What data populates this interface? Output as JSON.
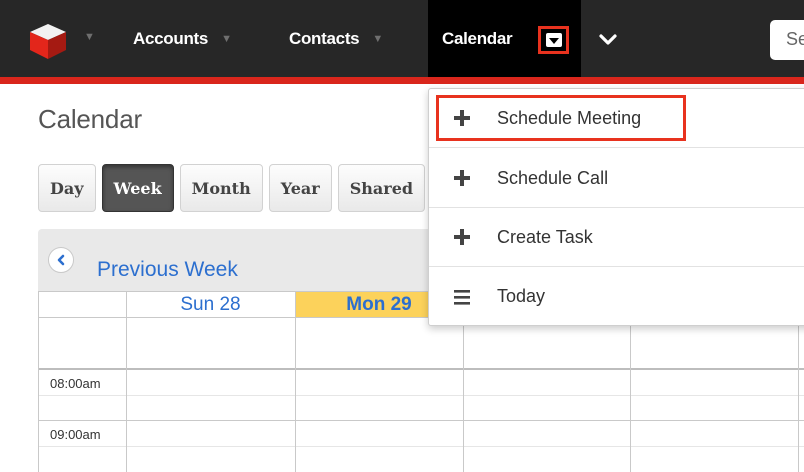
{
  "nav": {
    "items": [
      {
        "label": "Accounts"
      },
      {
        "label": "Contacts"
      },
      {
        "label": "Calendar"
      }
    ],
    "search_text": "Se"
  },
  "page": {
    "title": "Calendar"
  },
  "view_buttons": [
    "Day",
    "Week",
    "Month",
    "Year",
    "Shared"
  ],
  "active_view": "Week",
  "calendar": {
    "prev_label": "Previous Week",
    "days": [
      "Sun 28",
      "Mon 29"
    ],
    "today": "Mon 29",
    "time_labels": [
      "08:00am",
      "09:00am"
    ]
  },
  "dropdown": {
    "items": [
      {
        "label": "Schedule Meeting",
        "icon": "plus-icon"
      },
      {
        "label": "Schedule Call",
        "icon": "plus-icon"
      },
      {
        "label": "Create Task",
        "icon": "plus-icon"
      },
      {
        "label": "Today",
        "icon": "list-icon"
      }
    ]
  },
  "colors": {
    "nav_bg": "#272727",
    "accent_red": "#d9261c",
    "highlight_red": "#e8321e",
    "link_blue": "#2c6fcf",
    "today_yellow": "#fcd25b"
  }
}
